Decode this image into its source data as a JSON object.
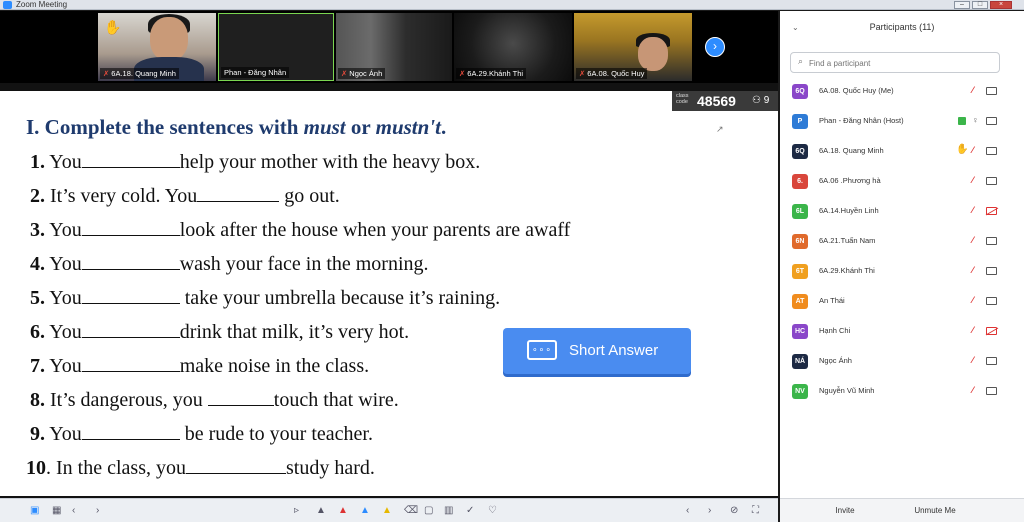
{
  "window": {
    "title": "Zoom Meeting"
  },
  "video_strip": {
    "tiles": [
      {
        "name": "6A.18. Quang Minh"
      },
      {
        "name": "Phan - Đăng Nhân"
      },
      {
        "name": "Ngọc Ánh"
      },
      {
        "name": "6A.29.Khánh Thi"
      },
      {
        "name": "6A.08. Quốc Huy"
      }
    ],
    "next_icon": "chevron-right-icon"
  },
  "class_code": {
    "label": "class code",
    "code": "48569",
    "participants": "9",
    "people_icon": "people-icon"
  },
  "exercise": {
    "title_prefix": "I. Complete the sentences with ",
    "title_must": "must",
    "title_or": " or ",
    "title_mustnt": "mustn't",
    "title_end": ".",
    "sentences": [
      {
        "num": "1.",
        "before": " You",
        "after": "help your mother with the heavy box."
      },
      {
        "num": "2.",
        "before": " It’s very cold. You",
        "after": " go out."
      },
      {
        "num": "3.",
        "before": " You",
        "after": "look after the house when your parents are awaff"
      },
      {
        "num": "4.",
        "before": " You",
        "after": "wash your face in the morning."
      },
      {
        "num": "5.",
        "before": " You",
        "after": " take your umbrella because it’s raining."
      },
      {
        "num": "6.",
        "before": " You",
        "after": "drink that milk, it’s very hot."
      },
      {
        "num": "7.",
        "before": " You",
        "after": "make noise in the class."
      },
      {
        "num": "8.",
        "before": " It’s dangerous, you ",
        "after": "touch that wire."
      },
      {
        "num": "9.",
        "before": " You",
        "after": " be rude to your teacher."
      },
      {
        "num": "10",
        "before": ". In the class, you",
        "after": "study hard."
      }
    ]
  },
  "short_answer": {
    "label": "Short Answer",
    "icon": "chat-bubble-icon"
  },
  "participants_panel": {
    "title": "Participants (11)",
    "search_placeholder": "Find a participant",
    "participants": [
      {
        "initials": "6Q",
        "name": "6A.08. Quốc Huy (Me)",
        "color": "#8a47c9",
        "hand": false,
        "muted": true,
        "video_off": false
      },
      {
        "initials": "P",
        "name": "Phan - Đăng Nhân (Host)",
        "color": "#2e7bd6",
        "hand": false,
        "muted": false,
        "video_off": false
      },
      {
        "initials": "6Q",
        "name": "6A.18. Quang Minh",
        "color": "#1d2a44",
        "hand": true,
        "muted": true,
        "video_off": false
      },
      {
        "initials": "6.",
        "name": "6A.06 .Phương hà",
        "color": "#d9463b",
        "hand": false,
        "muted": true,
        "video_off": false
      },
      {
        "initials": "6L",
        "name": "6A.14.Huyền Linh",
        "color": "#3bb54a",
        "hand": false,
        "muted": true,
        "video_off": true
      },
      {
        "initials": "6N",
        "name": "6A.21.Tuấn Nam",
        "color": "#e06a2c",
        "hand": false,
        "muted": true,
        "video_off": false
      },
      {
        "initials": "6T",
        "name": "6A.29.Khánh Thi",
        "color": "#f0a020",
        "hand": false,
        "muted": true,
        "video_off": false
      },
      {
        "initials": "AT",
        "name": "An Thái",
        "color": "#f08c1e",
        "hand": false,
        "muted": true,
        "video_off": false
      },
      {
        "initials": "HC",
        "name": "Hạnh Chi",
        "color": "#8a47c9",
        "hand": false,
        "muted": true,
        "video_off": true
      },
      {
        "initials": "NÁ",
        "name": "Ngọc Ánh",
        "color": "#1d2a44",
        "hand": false,
        "muted": true,
        "video_off": false
      },
      {
        "initials": "NV",
        "name": "Nguyễn Vũ Minh",
        "color": "#3bb54a",
        "hand": false,
        "muted": true,
        "video_off": false
      }
    ],
    "invite_label": "Invite",
    "unmute_label": "Unmute Me"
  }
}
